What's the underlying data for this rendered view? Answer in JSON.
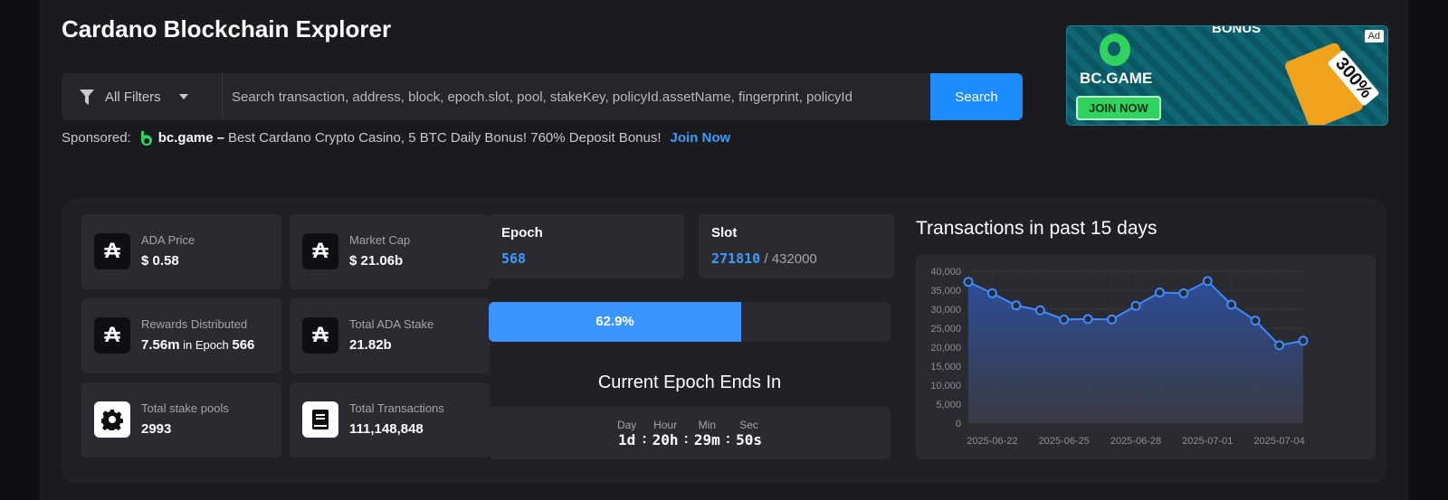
{
  "header": {
    "title": "Cardano Blockchain Explorer"
  },
  "search": {
    "filter_label": "All Filters",
    "placeholder": "Search transaction, address, block, epoch.slot, pool, stakeKey, policyId.assetName, fingerprint, policyId",
    "button_label": "Search"
  },
  "sponsored": {
    "label": "Sponsored:",
    "brand": "bc.game",
    "dash": "–",
    "text": "Best Cardano Crypto Casino, 5 BTC Daily Bonus! 760% Deposit Bonus!",
    "link": "Join Now"
  },
  "ad": {
    "tag": "Ad",
    "brand": "BC.GAME",
    "cta": "JOIN NOW",
    "headline": "BONUS",
    "percent": "300%"
  },
  "stats": [
    {
      "label": "ADA Price",
      "value": "$ 0.58",
      "icon": "ada-icon"
    },
    {
      "label": "Market Cap",
      "value": "$ 21.06b",
      "icon": "ada-icon"
    },
    {
      "label": "Rewards Distributed",
      "value": "7.56m",
      "suffix": " in Epoch ",
      "epoch": "566",
      "icon": "ada-icon"
    },
    {
      "label": "Total ADA Stake",
      "value": "21.82b",
      "icon": "ada-icon"
    },
    {
      "label": "Total stake pools",
      "value": "2993",
      "icon": "gear-icon"
    },
    {
      "label": "Total Transactions",
      "value": "111,148,848",
      "icon": "book-icon"
    }
  ],
  "epoch": {
    "label": "Epoch",
    "value": "568"
  },
  "slot": {
    "label": "Slot",
    "current": "271810",
    "separator": " / ",
    "total": "432000"
  },
  "progress": {
    "percent": 62.9,
    "text": "62.9%"
  },
  "countdown": {
    "title": "Current Epoch Ends In",
    "units": [
      {
        "label": "Day",
        "value": "1d"
      },
      {
        "label": "Hour",
        "value": "20h"
      },
      {
        "label": "Min",
        "value": "29m"
      },
      {
        "label": "Sec",
        "value": "50s"
      }
    ],
    "sep": ":"
  },
  "chart_data": {
    "type": "area",
    "title": "Transactions in past 15 days",
    "x": [
      "2025-06-21",
      "2025-06-22",
      "2025-06-23",
      "2025-06-24",
      "2025-06-25",
      "2025-06-26",
      "2025-06-27",
      "2025-06-28",
      "2025-06-29",
      "2025-06-30",
      "2025-07-01",
      "2025-07-02",
      "2025-07-03",
      "2025-07-04",
      "2025-07-05"
    ],
    "x_tick_labels": [
      "2025-06-22",
      "2025-06-25",
      "2025-06-28",
      "2025-07-01",
      "2025-07-04"
    ],
    "values": [
      37200,
      34200,
      31000,
      29700,
      27300,
      27400,
      27300,
      30900,
      34400,
      34200,
      37400,
      31200,
      27000,
      20500,
      21700
    ],
    "ylim": [
      0,
      40000
    ],
    "y_ticks": [
      0,
      5000,
      10000,
      15000,
      20000,
      25000,
      30000,
      35000,
      40000
    ],
    "y_tick_labels": [
      "0",
      "5,000",
      "10,000",
      "15,000",
      "20,000",
      "25,000",
      "30,000",
      "35,000",
      "40,000"
    ],
    "grid": true,
    "colors": {
      "line": "#3d8bff",
      "fill_top": "#2c4f9c",
      "fill_bottom": "#3a3b44"
    }
  }
}
